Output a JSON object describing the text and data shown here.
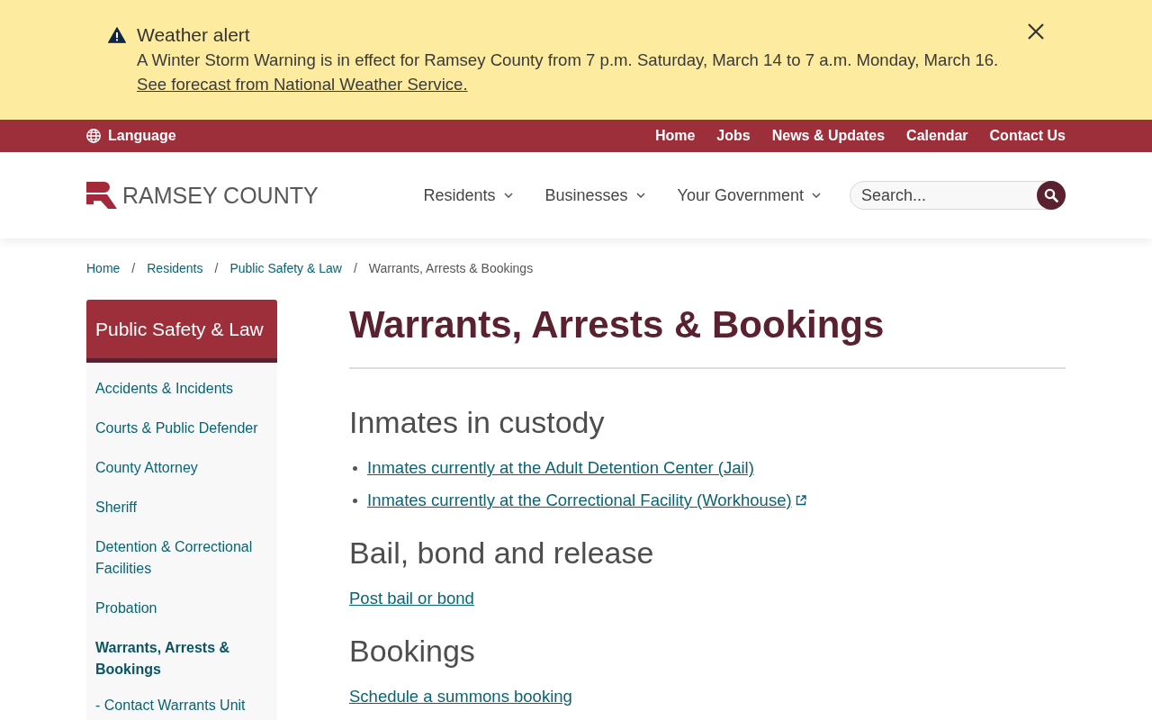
{
  "alert": {
    "title": "Weather alert",
    "message": "A Winter Storm Warning is in effect for Ramsey County from 7 p.m. Saturday, March 14 to 7 a.m. Monday, March 16.",
    "link": "See forecast from National Weather Service."
  },
  "utility_bar": {
    "language": "Language",
    "links": [
      "Home",
      "Jobs",
      "News & Updates",
      "Calendar",
      "Contact Us"
    ]
  },
  "header": {
    "logo": "RAMSEY COUNTY",
    "nav": [
      "Residents",
      "Businesses",
      "Your Government"
    ],
    "search": {
      "placeholder": "Search..."
    }
  },
  "breadcrumb": {
    "separator": "/",
    "items": [
      {
        "label": "Home",
        "current": false
      },
      {
        "label": "Residents",
        "current": false
      },
      {
        "label": "Public Safety & Law",
        "current": false
      },
      {
        "label": "Warrants, Arrests & Bookings",
        "current": true
      }
    ]
  },
  "sidebar": {
    "title": "Public Safety & Law",
    "items": [
      {
        "label": "Accidents & Incidents",
        "selected": false
      },
      {
        "label": "Courts & Public Defender",
        "selected": false
      },
      {
        "label": "County Attorney",
        "selected": false
      },
      {
        "label": "Sheriff",
        "selected": false
      },
      {
        "label": "Detention & Correctional Facilities",
        "selected": false
      },
      {
        "label": "Probation",
        "selected": false
      },
      {
        "label": "Warrants, Arrests & Bookings",
        "selected": true,
        "children": [
          {
            "label": "- Contact Warrants Unit",
            "selected": false
          }
        ]
      }
    ]
  },
  "content": {
    "title": "Warrants, Arrests & Bookings",
    "sections": [
      {
        "heading": "Inmates in custody",
        "kind": "bullet_list",
        "links": [
          {
            "label": "Inmates currently at the Adult Detention Center (Jail)",
            "external": false
          },
          {
            "label": "Inmates currently at the Correctional Facility (Workhouse)",
            "external": true
          }
        ]
      },
      {
        "heading": "Bail, bond and release",
        "kind": "links",
        "links": [
          {
            "label": "Post bail or bond",
            "external": false
          }
        ]
      },
      {
        "heading": "Bookings",
        "kind": "links",
        "links": [
          {
            "label": "Schedule a summons booking",
            "external": false
          }
        ]
      }
    ]
  }
}
